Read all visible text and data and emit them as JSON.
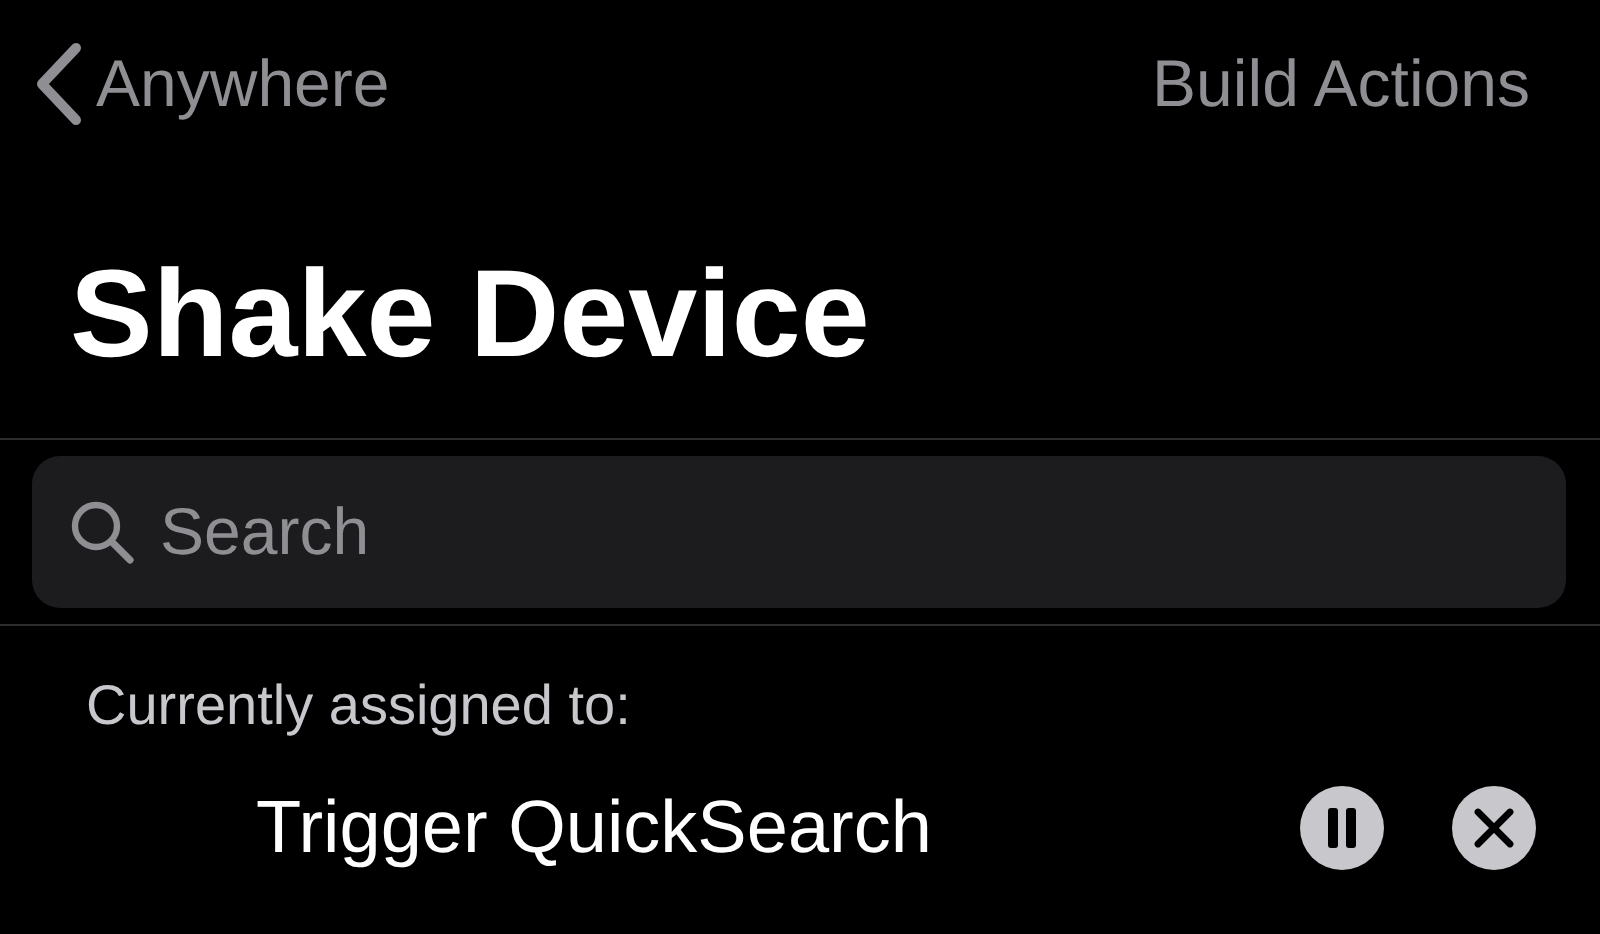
{
  "nav": {
    "back_label": "Anywhere",
    "action_label": "Build Actions"
  },
  "title": "Shake Device",
  "search": {
    "placeholder": "Search"
  },
  "section_label": "Currently assigned to:",
  "assignments": [
    {
      "name": "Trigger QuickSearch"
    }
  ]
}
